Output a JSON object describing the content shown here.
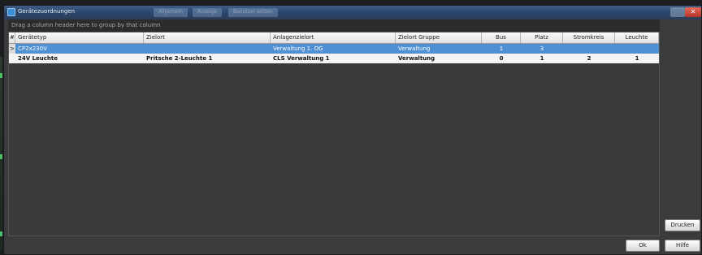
{
  "window": {
    "title": "Gerätezuordnungen",
    "ghost_tabs": [
      "Allgemein",
      "Anzeige",
      "Benutzer setzen"
    ]
  },
  "grid": {
    "group_hint": "Drag a column header here to group by that column",
    "columns": [
      "#",
      "Gerätetyp",
      "Zielort",
      "Anlagenzielort",
      "Zielort Gruppe",
      "Bus",
      "Platz",
      "Stromkreis",
      "Leuchte"
    ],
    "rows": [
      {
        "indicator": ">",
        "selected": true,
        "geraetetyp": "CP2x230V",
        "zielort": "",
        "anlagenzielort": "Verwaltung 1. OG",
        "zielort_gruppe": "Verwaltung",
        "bus": "1",
        "platz": "3",
        "stromkreis": "",
        "leuchte": ""
      },
      {
        "indicator": "",
        "selected": false,
        "geraetetyp": "24V Leuchte",
        "zielort": "Pritsche 2-Leuchte 1",
        "anlagenzielort": "CLS Verwaltung 1",
        "zielort_gruppe": "Verwaltung",
        "bus": "0",
        "platz": "1",
        "stromkreis": "2",
        "leuchte": "1"
      }
    ]
  },
  "buttons": {
    "print": "Drucken",
    "ok": "Ok",
    "help": "Hilfe"
  },
  "colors": {
    "selection": "#4f8fd3",
    "titlebar": "#2a4468",
    "close": "#c8453a"
  }
}
